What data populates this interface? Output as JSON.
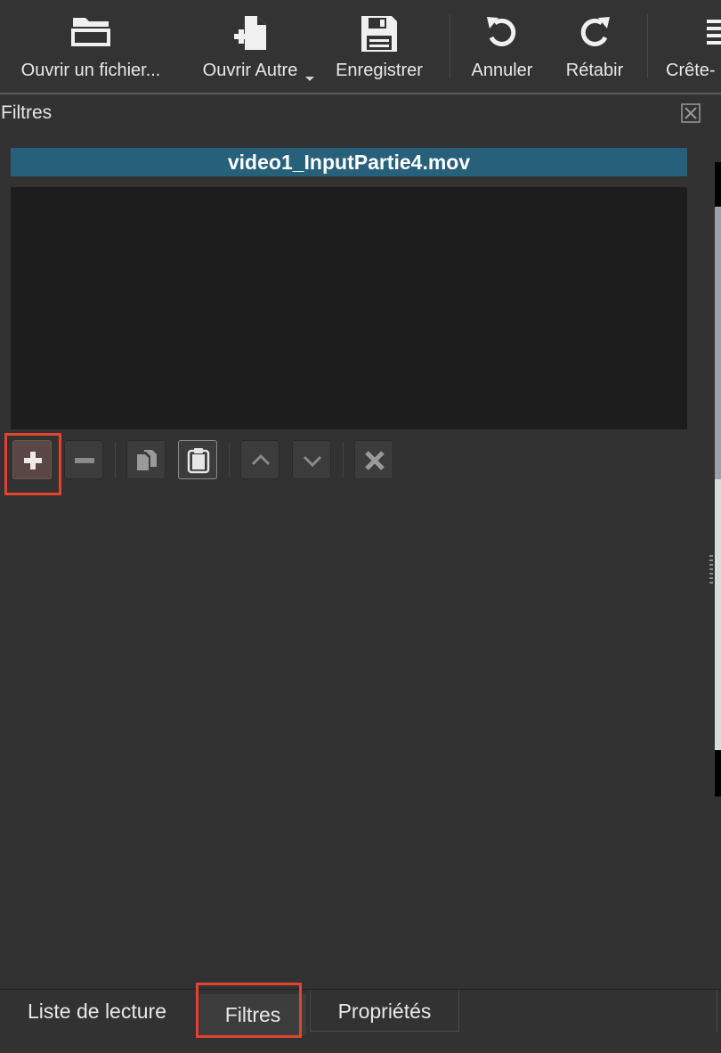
{
  "toolbar": {
    "open_file": {
      "label": "Ouvrir un fichier...",
      "icon": "folder-open-icon"
    },
    "open_other": {
      "label": "Ouvrir Autre",
      "icon": "new-file-icon"
    },
    "save": {
      "label": "Enregistrer",
      "icon": "floppy-disk-icon"
    },
    "undo": {
      "label": "Annuler",
      "icon": "undo-icon"
    },
    "redo": {
      "label": "Rétabir",
      "icon": "redo-icon"
    },
    "peak_meter": {
      "label": "Crête-",
      "icon": "peak-meter-icon"
    }
  },
  "panel": {
    "title": "Filtres",
    "clip_name": "video1_InputPartie4.mov"
  },
  "filter_actions": [
    {
      "name": "add-filter-button",
      "icon": "plus-icon"
    },
    {
      "name": "remove-filter-button",
      "icon": "minus-icon"
    },
    {
      "name": "copy-filters-button",
      "icon": "copy-icon"
    },
    {
      "name": "paste-filters-button",
      "icon": "clipboard-icon"
    },
    {
      "name": "move-filter-up-button",
      "icon": "chevron-up-icon"
    },
    {
      "name": "move-filter-down-button",
      "icon": "chevron-down-icon"
    },
    {
      "name": "deselect-filter-button",
      "icon": "close-icon"
    }
  ],
  "tabs": {
    "playlist": "Liste de lecture",
    "filters": "Filtres",
    "properties": "Propriétés",
    "active": "filters"
  },
  "colors": {
    "highlight": "#e4432e",
    "banner": "#27607a",
    "background": "#323232"
  }
}
